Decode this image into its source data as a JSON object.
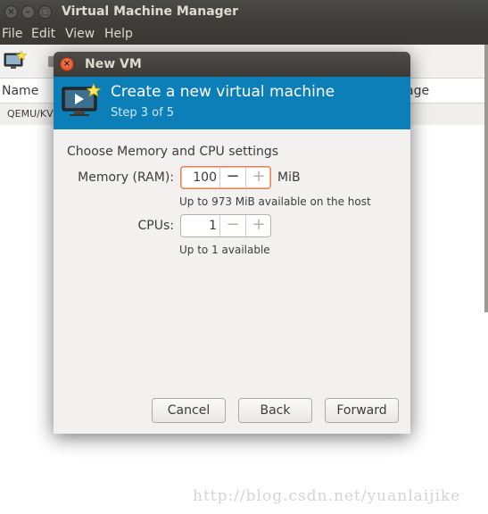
{
  "main_window": {
    "title": "Virtual Machine Manager",
    "menu": [
      "File",
      "Edit",
      "View",
      "Help"
    ],
    "columns": {
      "name": "Name",
      "usage_partial": "age"
    },
    "rows": [
      {
        "connection": "QEMU/KV"
      }
    ],
    "window_buttons": {
      "close": "×",
      "minimize": "–",
      "maximize": "□"
    }
  },
  "dialog": {
    "title": "New VM",
    "close_glyph": "×",
    "header": {
      "title": "Create a new virtual machine",
      "step": "Step 3 of 5"
    },
    "section_title": "Choose Memory and CPU settings",
    "memory": {
      "label": "Memory (RAM):",
      "value": "100",
      "unit": "MiB",
      "hint": "Up to 973 MiB available on the host",
      "minus": "−",
      "plus": "+"
    },
    "cpus": {
      "label": "CPUs:",
      "value": "1",
      "hint": "Up to 1 available",
      "minus": "−",
      "plus": "+"
    },
    "buttons": {
      "cancel": "Cancel",
      "back": "Back",
      "forward": "Forward"
    }
  },
  "watermark": "http://blog.csdn.net/yuanlaijike",
  "colors": {
    "header_blue": "#0c7fb8",
    "titlebar": "#3c3b37",
    "dialog_bg": "#f2f1f0",
    "focus_orange": "#e5835c",
    "close_orange": "#d6451b"
  }
}
